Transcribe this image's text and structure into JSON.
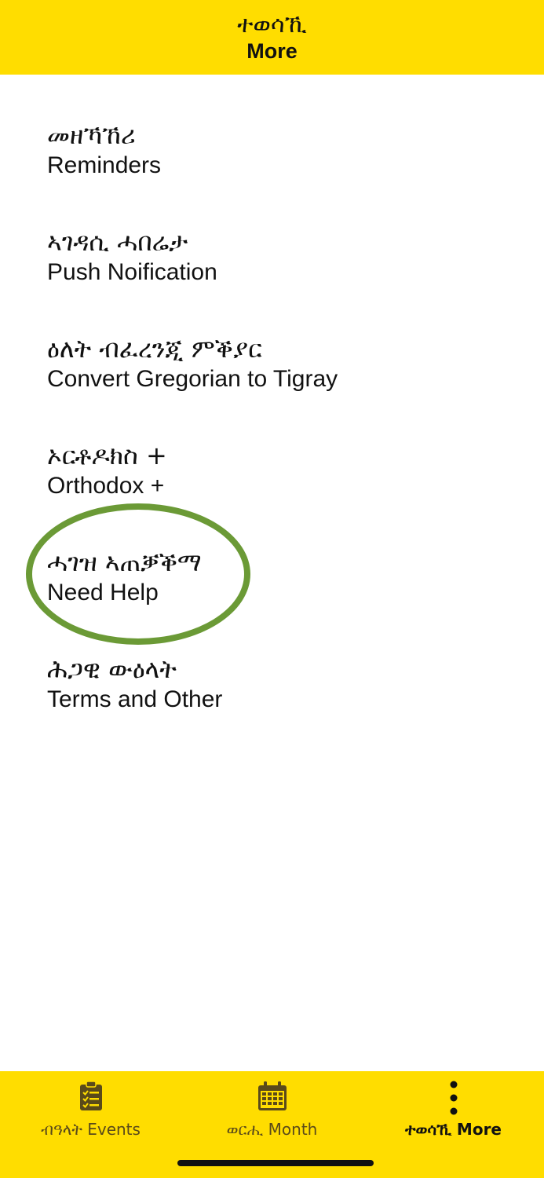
{
  "header": {
    "title_am": "ተወሳኺ",
    "title_en": "More"
  },
  "menu": {
    "items": [
      {
        "am": "መዘኻኸሪ",
        "en": "Reminders"
      },
      {
        "am": "ኣገዳሲ ሓበሬታ",
        "en": "Push Noification"
      },
      {
        "am": "ዕለት ብፈረንጂ ምቕያር",
        "en": "Convert Gregorian to Tigray"
      },
      {
        "am": "ኦርቶዶክስ +",
        "en": "Orthodox +"
      },
      {
        "am": "ሓገዝ ኣጠቓቕማ",
        "en": "Need Help"
      },
      {
        "am": "ሕጋዊ ውዕላት",
        "en": "Terms and Other"
      }
    ],
    "highlighted_item": "Need Help"
  },
  "tabbar": {
    "tabs": [
      {
        "label": "ብዓላት Events",
        "icon": "checklist-icon",
        "active": false
      },
      {
        "label": "ወርሒ Month",
        "icon": "calendar-icon",
        "active": false
      },
      {
        "label": "ተወሳኺ More",
        "icon": "more-vertical-icon",
        "active": true
      }
    ]
  },
  "colors": {
    "accent": "#FFDD00",
    "highlight": "#6B9A36",
    "text": "#111111"
  }
}
